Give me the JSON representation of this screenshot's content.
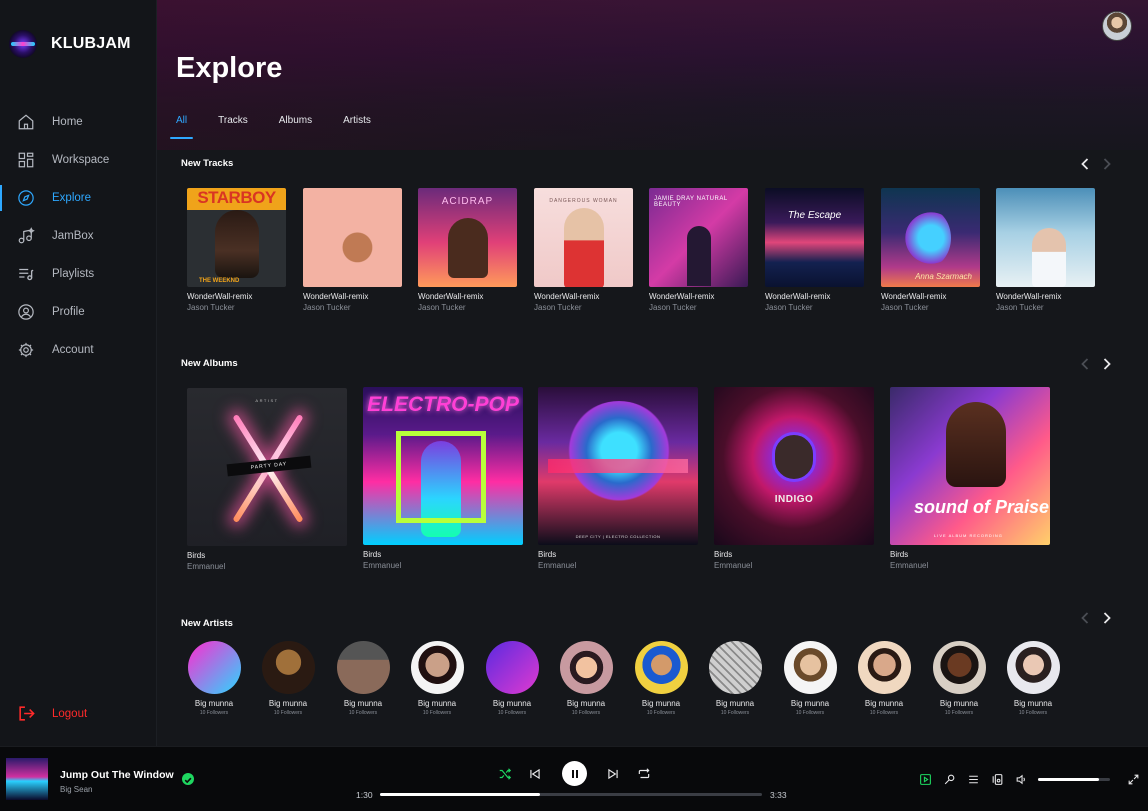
{
  "app": {
    "name": "KLUBJAM"
  },
  "sidebar": {
    "items": [
      {
        "label": "Home",
        "icon": "home-icon"
      },
      {
        "label": "Workspace",
        "icon": "grid-icon"
      },
      {
        "label": "Explore",
        "icon": "compass-icon",
        "active": true
      },
      {
        "label": "JamBox",
        "icon": "music-note-icon"
      },
      {
        "label": "Playlists",
        "icon": "playlist-icon"
      },
      {
        "label": "Profile",
        "icon": "user-circle-icon"
      },
      {
        "label": "Account",
        "icon": "gear-icon"
      }
    ],
    "logout": "Logout"
  },
  "header": {
    "title": "Explore"
  },
  "tabs": [
    {
      "label": "All",
      "active": true
    },
    {
      "label": "Tracks"
    },
    {
      "label": "Albums"
    },
    {
      "label": "Artists"
    }
  ],
  "sections": {
    "new_tracks": {
      "title": "New Tracks",
      "items": [
        {
          "title": "WonderWall-remix",
          "artist": "Jason Tucker",
          "cover_text": "STARBOY",
          "cover_sub": "THE WEEKND"
        },
        {
          "title": "WonderWall-remix",
          "artist": "Jason Tucker",
          "cover_text": ""
        },
        {
          "title": "WonderWall-remix",
          "artist": "Jason Tucker",
          "cover_text": "ACIDRAP"
        },
        {
          "title": "WonderWall-remix",
          "artist": "Jason Tucker",
          "cover_text": "DANGEROUS WOMAN"
        },
        {
          "title": "WonderWall-remix",
          "artist": "Jason Tucker",
          "cover_text": "JAMIE DRAY  NATURAL BEAUTY"
        },
        {
          "title": "WonderWall-remix",
          "artist": "Jason Tucker",
          "cover_text": "The Escape"
        },
        {
          "title": "WonderWall-remix",
          "artist": "Jason Tucker",
          "cover_text": "Anna Szarmach"
        },
        {
          "title": "WonderWall-remix",
          "artist": "Jason Tucker",
          "cover_text": ""
        }
      ]
    },
    "new_albums": {
      "title": "New Albums",
      "items": [
        {
          "title": "Birds",
          "artist": "Emmanuel",
          "cover_text": "PARTY DAY",
          "cover_top": "ARTIST"
        },
        {
          "title": "Birds",
          "artist": "Emmanuel",
          "cover_text": "ELECTRO-POP"
        },
        {
          "title": "Birds",
          "artist": "Emmanuel",
          "cover_text": "DEEP CITY | ELECTRO COLLECTION"
        },
        {
          "title": "Birds",
          "artist": "Emmanuel",
          "cover_text": "INDIGO"
        },
        {
          "title": "Birds",
          "artist": "Emmanuel",
          "cover_text": "sound of Praise",
          "cover_sub": "LIVE ALBUM RECORDING"
        }
      ]
    },
    "new_artists": {
      "title": "New Artists",
      "items": [
        {
          "name": "Big munna",
          "followers": "10 Followers"
        },
        {
          "name": "Big munna",
          "followers": "10 Followers"
        },
        {
          "name": "Big munna",
          "followers": "10 Followers"
        },
        {
          "name": "Big munna",
          "followers": "10 Followers"
        },
        {
          "name": "Big munna",
          "followers": "10 Followers"
        },
        {
          "name": "Big munna",
          "followers": "10 Followers"
        },
        {
          "name": "Big munna",
          "followers": "10 Followers"
        },
        {
          "name": "Big munna",
          "followers": "10 Followers"
        },
        {
          "name": "Big munna",
          "followers": "10 Followers"
        },
        {
          "name": "Big munna",
          "followers": "10 Followers"
        },
        {
          "name": "Big munna",
          "followers": "10 Followers"
        },
        {
          "name": "Big munna",
          "followers": "10 Followers"
        }
      ]
    }
  },
  "player": {
    "title": "Jump Out The Window",
    "artist": "Big Sean",
    "elapsed": "1:30",
    "duration": "3:33",
    "progress": 0.42,
    "volume": 0.85
  },
  "colors": {
    "accent": "#2ea8ff",
    "logout": "#ff2a2a",
    "green": "#1ed760"
  }
}
